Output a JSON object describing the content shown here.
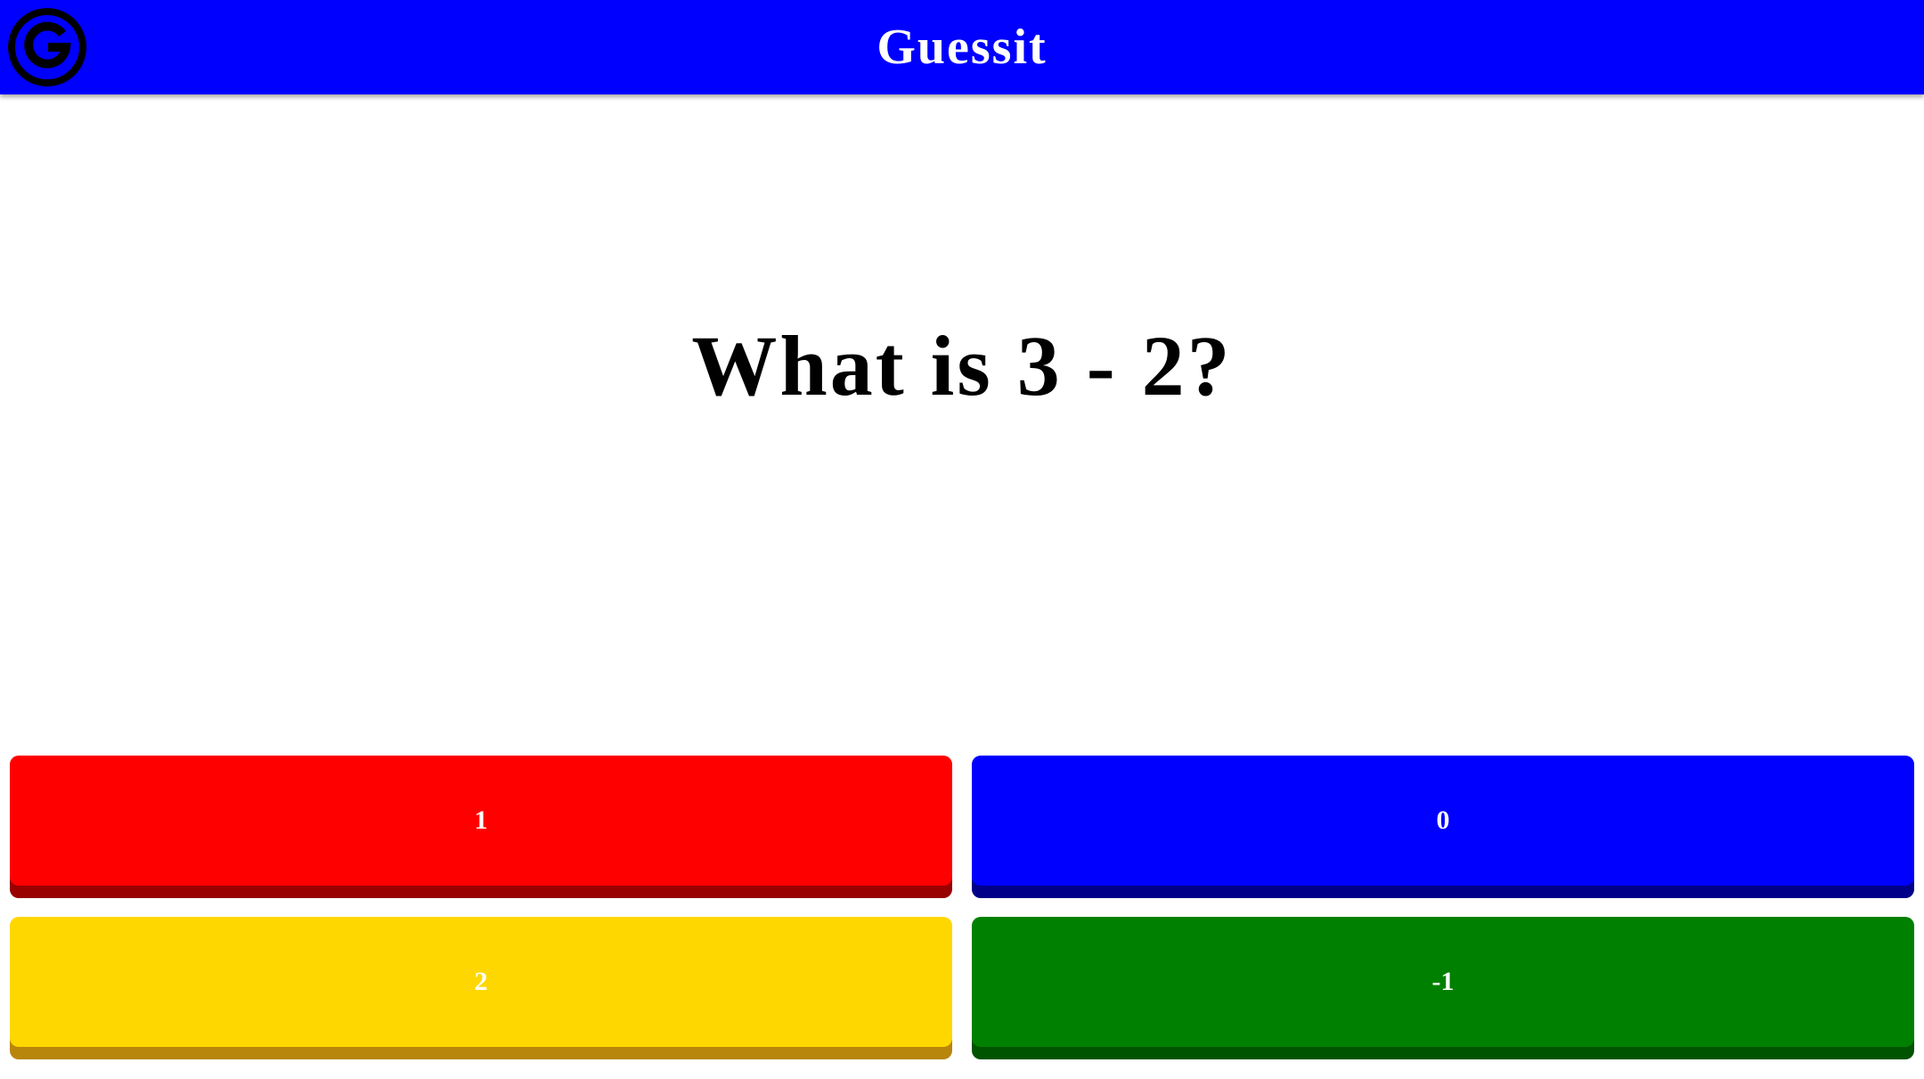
{
  "header": {
    "title": "Guessit",
    "logo_icon": "g-logo-icon",
    "background_color": "#0000ff"
  },
  "question": {
    "text": "What is 3 - 2?"
  },
  "answers": [
    {
      "label": "1",
      "color": "#ff0000",
      "shadow": "#990000"
    },
    {
      "label": "0",
      "color": "#0000ff",
      "shadow": "#000088"
    },
    {
      "label": "2",
      "color": "#ffd700",
      "shadow": "#b8860b"
    },
    {
      "label": "-1",
      "color": "#008000",
      "shadow": "#005400"
    }
  ]
}
